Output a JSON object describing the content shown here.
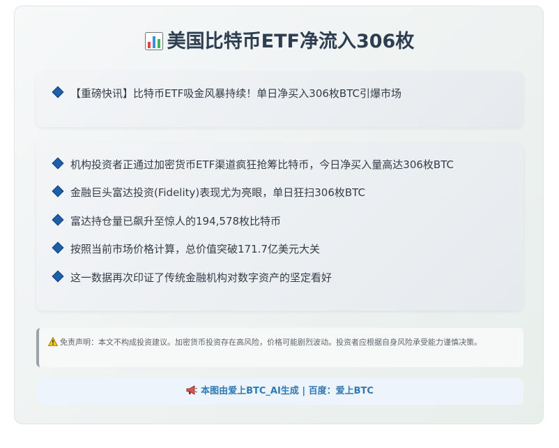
{
  "header": {
    "icon": "bar-chart-icon",
    "title": "美国比特币ETF净流入306枚"
  },
  "headline": {
    "text": "【重磅快讯】比特币ETF吸金风暴持续！单日净买入306枚BTC引爆市场"
  },
  "points": [
    "机构投资者正通过加密货币ETF渠道疯狂抢筹比特币，今日净买入量高达306枚BTC",
    "金融巨头富达投资(Fidelity)表现尤为亮眼，单日狂扫306枚BTC",
    "富达持仓量已飙升至惊人的194,578枚比特币",
    "按照当前市场价格计算，总价值突破171.7亿美元大关",
    "这一数据再次印证了传统金融机构对数字资产的坚定看好"
  ],
  "disclaimer": {
    "icon": "warning-icon",
    "text": "免责声明：本文不构成投资建议。加密货币投资存在高风险，价格可能剧烈波动。投资者应根据自身风险承受能力谨慎决策。"
  },
  "footer": {
    "icon": "megaphone-icon",
    "text": "本图由爱上BTC_AI生成 | 百度：爱上BTC"
  },
  "colors": {
    "bullet": "#1d5fa8",
    "title": "#2c3e50",
    "footer_text": "#2f79b8"
  }
}
